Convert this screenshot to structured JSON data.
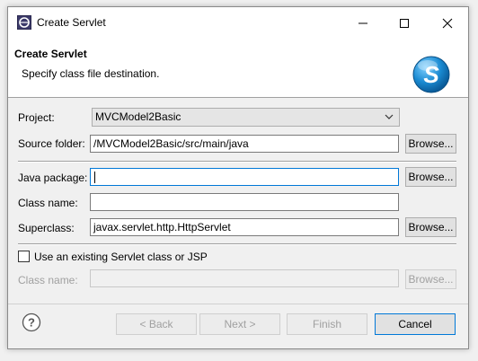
{
  "window": {
    "title": "Create Servlet",
    "min_glyph": "—",
    "max_glyph": "☐",
    "close_glyph": "✕"
  },
  "header": {
    "title": "Create Servlet",
    "description": "Specify class file destination."
  },
  "form": {
    "project": {
      "label": "Project:",
      "value": "MVCModel2Basic"
    },
    "source_folder": {
      "label": "Source folder:",
      "value": "/MVCModel2Basic/src/main/java",
      "browse": "Browse..."
    },
    "java_package": {
      "label": "Java package:",
      "value": "",
      "browse": "Browse..."
    },
    "class_name": {
      "label": "Class name:",
      "value": ""
    },
    "superclass": {
      "label": "Superclass:",
      "value": "javax.servlet.http.HttpServlet",
      "browse": "Browse..."
    },
    "use_existing": {
      "label": "Use an existing Servlet class or JSP",
      "checked": false
    },
    "existing_class": {
      "label": "Class name:",
      "value": "",
      "browse": "Browse..."
    }
  },
  "footer": {
    "back": "< Back",
    "next": "Next >",
    "finish": "Finish",
    "cancel": "Cancel"
  },
  "colors": {
    "accent": "#0078d7",
    "logo_blue": "#1a8ad1"
  }
}
